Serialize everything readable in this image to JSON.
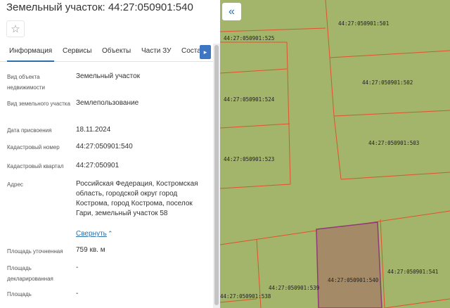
{
  "header": {
    "title": "Земельный участок: 44:27:050901:540"
  },
  "tabs": [
    {
      "label": "Информация"
    },
    {
      "label": "Сервисы"
    },
    {
      "label": "Объекты"
    },
    {
      "label": "Части ЗУ"
    },
    {
      "label": "Состав"
    }
  ],
  "fields": {
    "object_type": {
      "label": "Вид объекта недвижимости",
      "value": "Земельный участок"
    },
    "land_type": {
      "label": "Вид земельного участка",
      "value": "Землепользование"
    },
    "assigned_date": {
      "label": "Дата присвоения",
      "value": "18.11.2024"
    },
    "cadastral_number": {
      "label": "Кадастровый номер",
      "value": "44:27:050901:540"
    },
    "cadastral_block": {
      "label": "Кадастровый квартал",
      "value": "44:27:050901"
    },
    "address": {
      "label": "Адрес",
      "value": "Российская Федерация, Костромская область, городской округ город Кострома, город Кострома, поселок Гари, земельный участок 58",
      "collapse_label": "Свернуть"
    },
    "area_specified": {
      "label": "Площадь уточненная",
      "value": "759 кв. м"
    },
    "area_declared": {
      "label": "Площадь декларированная",
      "value": "-"
    },
    "area": {
      "label": "Площадь",
      "value": "-"
    }
  },
  "map": {
    "parcels": [
      "44:27:050901:525",
      "44:27:050901:501",
      "44:27:050901:502",
      "44:27:050901:524",
      "44:27:050901:503",
      "44:27:050901:523",
      "44:27:050901:541",
      "44:27:050901:540",
      "44:27:050901:539",
      "44:27:050901:538"
    ],
    "colors": {
      "land": "#a3b46b",
      "boundary": "#e0522d",
      "selected_fill": "#a48a66",
      "selected_border": "#8f3a78"
    }
  }
}
